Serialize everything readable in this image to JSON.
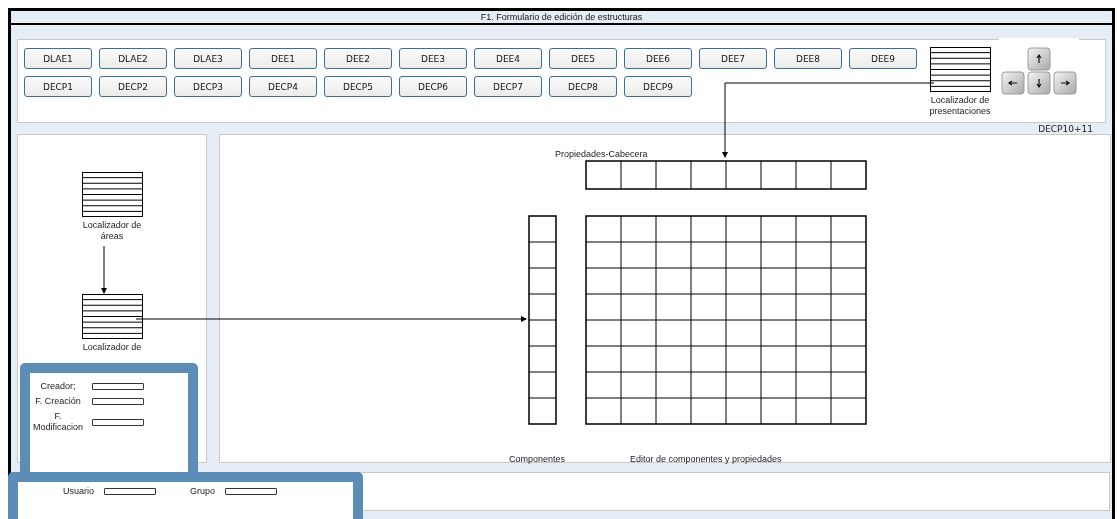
{
  "window": {
    "title": "F1. Formulario de edición de estructuras"
  },
  "toolbar": {
    "rows": [
      [
        "DLAE1",
        "DLAE2",
        "DLAE3",
        "DEE1",
        "DEE2",
        "DEE3",
        "DEE4",
        "DEE5",
        "DEE6",
        "DEE7",
        "DEE8",
        "DEE9"
      ],
      [
        "DECP1",
        "DECP2",
        "DECP3",
        "DECP4",
        "DECP5",
        "DECP6",
        "DECP7",
        "DECP8",
        "DECP9"
      ]
    ]
  },
  "presentation_locator": {
    "label": "Localizador de presentaciones"
  },
  "shortcut_label": "DECP10+11",
  "left_panel": {
    "locators": [
      {
        "label": "Localizador de áreas"
      },
      {
        "label": "Localizador de"
      }
    ]
  },
  "editor": {
    "header_label": "Propiedades-Cabecera",
    "components_label": "Componentes",
    "editor_label": "Editor de componentes y propiedades"
  },
  "metadata": {
    "fields": [
      {
        "label": "Creador;"
      },
      {
        "label": "F. Creación"
      },
      {
        "label": "F. Modificacion"
      }
    ]
  },
  "footer": {
    "fields": [
      {
        "label": "Usuario"
      },
      {
        "label": "Grupo"
      }
    ]
  }
}
